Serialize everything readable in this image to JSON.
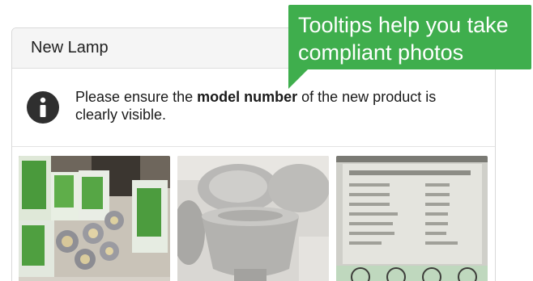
{
  "card": {
    "title": "New Lamp"
  },
  "notice": {
    "icon": "info-icon",
    "text_before": "Please ensure the ",
    "text_bold": "model number",
    "text_after": " of the new product is clearly visible."
  },
  "photos": [
    {
      "name": "lamp-boxes-photo",
      "description_icon": "photo"
    },
    {
      "name": "lamp-bulb-photo",
      "description_icon": "photo"
    },
    {
      "name": "lamp-label-photo",
      "description_icon": "photo"
    }
  ],
  "tooltip": {
    "line1": "Tooltips help you take",
    "line2": "compliant photos",
    "color": "#3fae4d"
  }
}
